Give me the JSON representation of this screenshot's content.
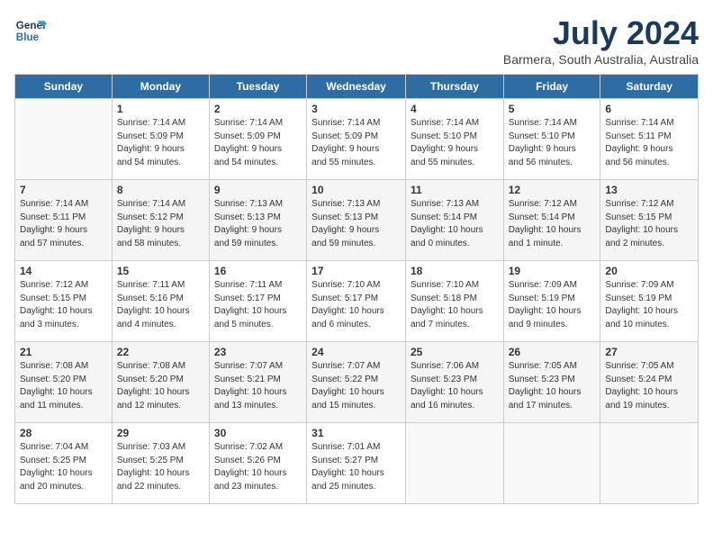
{
  "header": {
    "logo_line1": "General",
    "logo_line2": "Blue",
    "month": "July 2024",
    "location": "Barmera, South Australia, Australia"
  },
  "days_of_week": [
    "Sunday",
    "Monday",
    "Tuesday",
    "Wednesday",
    "Thursday",
    "Friday",
    "Saturday"
  ],
  "weeks": [
    [
      {
        "day": "",
        "info": ""
      },
      {
        "day": "1",
        "info": "Sunrise: 7:14 AM\nSunset: 5:09 PM\nDaylight: 9 hours\nand 54 minutes."
      },
      {
        "day": "2",
        "info": "Sunrise: 7:14 AM\nSunset: 5:09 PM\nDaylight: 9 hours\nand 54 minutes."
      },
      {
        "day": "3",
        "info": "Sunrise: 7:14 AM\nSunset: 5:09 PM\nDaylight: 9 hours\nand 55 minutes."
      },
      {
        "day": "4",
        "info": "Sunrise: 7:14 AM\nSunset: 5:10 PM\nDaylight: 9 hours\nand 55 minutes."
      },
      {
        "day": "5",
        "info": "Sunrise: 7:14 AM\nSunset: 5:10 PM\nDaylight: 9 hours\nand 56 minutes."
      },
      {
        "day": "6",
        "info": "Sunrise: 7:14 AM\nSunset: 5:11 PM\nDaylight: 9 hours\nand 56 minutes."
      }
    ],
    [
      {
        "day": "7",
        "info": "Sunrise: 7:14 AM\nSunset: 5:11 PM\nDaylight: 9 hours\nand 57 minutes."
      },
      {
        "day": "8",
        "info": "Sunrise: 7:14 AM\nSunset: 5:12 PM\nDaylight: 9 hours\nand 58 minutes."
      },
      {
        "day": "9",
        "info": "Sunrise: 7:13 AM\nSunset: 5:13 PM\nDaylight: 9 hours\nand 59 minutes."
      },
      {
        "day": "10",
        "info": "Sunrise: 7:13 AM\nSunset: 5:13 PM\nDaylight: 9 hours\nand 59 minutes."
      },
      {
        "day": "11",
        "info": "Sunrise: 7:13 AM\nSunset: 5:14 PM\nDaylight: 10 hours\nand 0 minutes."
      },
      {
        "day": "12",
        "info": "Sunrise: 7:12 AM\nSunset: 5:14 PM\nDaylight: 10 hours\nand 1 minute."
      },
      {
        "day": "13",
        "info": "Sunrise: 7:12 AM\nSunset: 5:15 PM\nDaylight: 10 hours\nand 2 minutes."
      }
    ],
    [
      {
        "day": "14",
        "info": "Sunrise: 7:12 AM\nSunset: 5:15 PM\nDaylight: 10 hours\nand 3 minutes."
      },
      {
        "day": "15",
        "info": "Sunrise: 7:11 AM\nSunset: 5:16 PM\nDaylight: 10 hours\nand 4 minutes."
      },
      {
        "day": "16",
        "info": "Sunrise: 7:11 AM\nSunset: 5:17 PM\nDaylight: 10 hours\nand 5 minutes."
      },
      {
        "day": "17",
        "info": "Sunrise: 7:10 AM\nSunset: 5:17 PM\nDaylight: 10 hours\nand 6 minutes."
      },
      {
        "day": "18",
        "info": "Sunrise: 7:10 AM\nSunset: 5:18 PM\nDaylight: 10 hours\nand 7 minutes."
      },
      {
        "day": "19",
        "info": "Sunrise: 7:09 AM\nSunset: 5:19 PM\nDaylight: 10 hours\nand 9 minutes."
      },
      {
        "day": "20",
        "info": "Sunrise: 7:09 AM\nSunset: 5:19 PM\nDaylight: 10 hours\nand 10 minutes."
      }
    ],
    [
      {
        "day": "21",
        "info": "Sunrise: 7:08 AM\nSunset: 5:20 PM\nDaylight: 10 hours\nand 11 minutes."
      },
      {
        "day": "22",
        "info": "Sunrise: 7:08 AM\nSunset: 5:20 PM\nDaylight: 10 hours\nand 12 minutes."
      },
      {
        "day": "23",
        "info": "Sunrise: 7:07 AM\nSunset: 5:21 PM\nDaylight: 10 hours\nand 13 minutes."
      },
      {
        "day": "24",
        "info": "Sunrise: 7:07 AM\nSunset: 5:22 PM\nDaylight: 10 hours\nand 15 minutes."
      },
      {
        "day": "25",
        "info": "Sunrise: 7:06 AM\nSunset: 5:23 PM\nDaylight: 10 hours\nand 16 minutes."
      },
      {
        "day": "26",
        "info": "Sunrise: 7:05 AM\nSunset: 5:23 PM\nDaylight: 10 hours\nand 17 minutes."
      },
      {
        "day": "27",
        "info": "Sunrise: 7:05 AM\nSunset: 5:24 PM\nDaylight: 10 hours\nand 19 minutes."
      }
    ],
    [
      {
        "day": "28",
        "info": "Sunrise: 7:04 AM\nSunset: 5:25 PM\nDaylight: 10 hours\nand 20 minutes."
      },
      {
        "day": "29",
        "info": "Sunrise: 7:03 AM\nSunset: 5:25 PM\nDaylight: 10 hours\nand 22 minutes."
      },
      {
        "day": "30",
        "info": "Sunrise: 7:02 AM\nSunset: 5:26 PM\nDaylight: 10 hours\nand 23 minutes."
      },
      {
        "day": "31",
        "info": "Sunrise: 7:01 AM\nSunset: 5:27 PM\nDaylight: 10 hours\nand 25 minutes."
      },
      {
        "day": "",
        "info": ""
      },
      {
        "day": "",
        "info": ""
      },
      {
        "day": "",
        "info": ""
      }
    ]
  ]
}
